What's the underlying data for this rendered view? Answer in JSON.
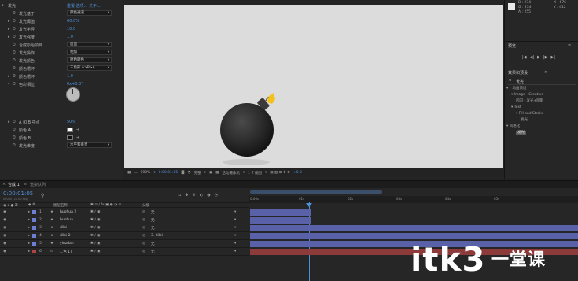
{
  "effect_controls": {
    "rows": [
      {
        "indent": 0,
        "twirl": "▾",
        "stopwatch": false,
        "label": "发光",
        "extra": "重置  选项...  关于..."
      },
      {
        "indent": 1,
        "twirl": "",
        "stopwatch": true,
        "label": "发光基于",
        "dropdown": "颜色通道"
      },
      {
        "indent": 1,
        "twirl": "▸",
        "stopwatch": true,
        "label": "发光阈值",
        "value": "60.0%"
      },
      {
        "indent": 1,
        "twirl": "▸",
        "stopwatch": true,
        "label": "发光半径",
        "value": "10.0"
      },
      {
        "indent": 1,
        "twirl": "▸",
        "stopwatch": true,
        "label": "发光强度",
        "value": "1.0"
      },
      {
        "indent": 1,
        "twirl": "",
        "stopwatch": true,
        "label": "合成原始项目",
        "dropdown": "后面"
      },
      {
        "indent": 1,
        "twirl": "",
        "stopwatch": true,
        "label": "发光操作",
        "dropdown": "相加"
      },
      {
        "indent": 1,
        "twirl": "",
        "stopwatch": true,
        "label": "发光颜色",
        "dropdown": "原始颜色"
      },
      {
        "indent": 1,
        "twirl": "",
        "stopwatch": true,
        "label": "颜色循环",
        "dropdown": "三角形 A>B>A"
      },
      {
        "indent": 1,
        "twirl": "▸",
        "stopwatch": true,
        "label": "颜色循环",
        "value": "1.0"
      },
      {
        "indent": 1,
        "twirl": "▾",
        "stopwatch": true,
        "label": "色彩相位",
        "value": "0x+0.0°"
      },
      {
        "indent": 1,
        "twirl": "▸",
        "stopwatch": true,
        "label": "A 和 B 中点",
        "value": "50%"
      },
      {
        "indent": 1,
        "twirl": "",
        "stopwatch": true,
        "label": "颜色 A",
        "swatch": "#ffffff"
      },
      {
        "indent": 1,
        "twirl": "",
        "stopwatch": true,
        "label": "颜色 B",
        "swatch": "#111111"
      },
      {
        "indent": 1,
        "twirl": "",
        "stopwatch": true,
        "label": "发光维度",
        "dropdown": "水平和垂直"
      }
    ]
  },
  "viewer": {
    "toolbar": [
      "100%",
      "▾",
      "0:00:01:05",
      "完整",
      "▾",
      "活动摄像机",
      "▾",
      "1 个视图",
      "▾",
      "+0.0"
    ]
  },
  "right_panel": {
    "info_lines": [
      "B : 234",
      "G : 234",
      "A : 255"
    ],
    "info_xy": [
      "X : 676",
      "Y : 412"
    ],
    "preview_title": "预览",
    "preview_buttons": [
      "|◀",
      "◀|",
      "▶",
      "|▶",
      "▶|"
    ],
    "effects_title": "效果和预设",
    "search": "发光",
    "tree": [
      {
        "indent": 0,
        "text": "▾ * 动画预设"
      },
      {
        "indent": 1,
        "text": "▾ Image - Creative"
      },
      {
        "indent": 2,
        "text": "闪闪 - 发光+阴影"
      },
      {
        "indent": 1,
        "text": "▾ Text"
      },
      {
        "indent": 2,
        "text": "▾ Fill and Stroke"
      },
      {
        "indent": 3,
        "text": "发光"
      },
      {
        "indent": 0,
        "text": "▾ 风格化"
      },
      {
        "indent": 2,
        "text": "发光"
      }
    ]
  },
  "timeline": {
    "tabs": [
      {
        "label": "合成 1",
        "active": true
      },
      {
        "label": "渲染队列",
        "active": false
      }
    ],
    "timecode": "0:00:01:05",
    "fps": "00030 (25.00 fps)",
    "headers": {
      "name": "图层名称",
      "parent": "父级"
    },
    "ticks": [
      "0:00s",
      "01s",
      "02s",
      "03s",
      "04s",
      "05s"
    ],
    "layers": [
      {
        "num": "1",
        "name": "huohua 2",
        "parent": "无",
        "color": "#6c7fd2"
      },
      {
        "num": "2",
        "name": "huohua",
        "parent": "无",
        "color": "#6c7fd2"
      },
      {
        "num": "3",
        "name": "dilei",
        "parent": "无",
        "color": "#6c7fd2"
      },
      {
        "num": "4",
        "name": "dilei 2",
        "parent": "3. dilei",
        "color": "#6c7fd2"
      },
      {
        "num": "5",
        "name": "yinzdan",
        "parent": "无",
        "color": "#6c7fd2"
      },
      {
        "num": "6",
        "name": "...色 1]",
        "parent": "无",
        "color": "#b04444"
      }
    ]
  },
  "watermark": "itk3",
  "watermark_cn": "一堂课",
  "colors": {
    "accent": "#4f8fd8",
    "bar_blue": "#5962a8",
    "bar_red": "#8d3a3a",
    "viewer_bg": "#dcdcdc"
  }
}
